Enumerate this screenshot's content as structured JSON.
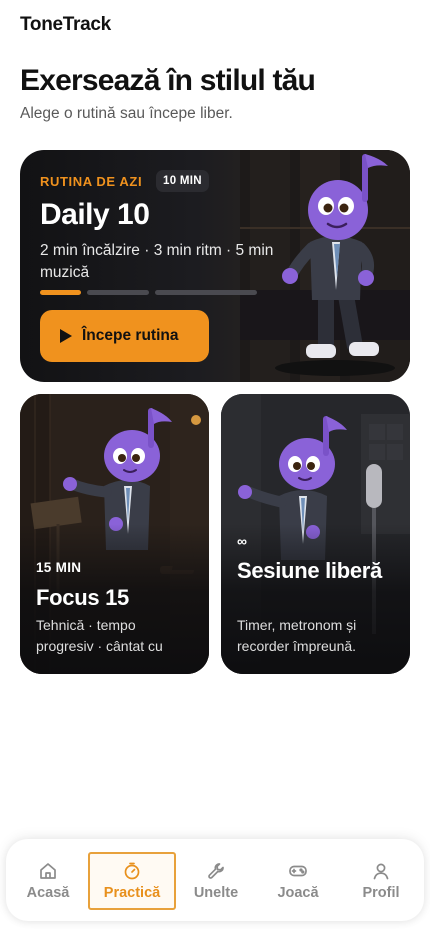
{
  "app": {
    "title": "ToneTrack"
  },
  "page": {
    "title": "Exersează în stilul tău",
    "subtitle": "Alege o rutină sau începe liber."
  },
  "hero": {
    "kicker": "RUTINA DE AZI",
    "badge": "10 MIN",
    "title": "Daily 10",
    "description": "2 min încălzire · 3 min ritm · 5 min muzică",
    "progress_segments_minutes": [
      2,
      3,
      5
    ],
    "active_segment": 1,
    "cta_label": "Începe rutina"
  },
  "cards": [
    {
      "kicker": "15 MIN",
      "title": "Focus 15",
      "description": "Tehnică · tempo progresiv · cântat cu metronom"
    },
    {
      "kicker": "∞",
      "title": "Sesiune liberă",
      "description": "Timer, metronom și recorder împreună."
    }
  ],
  "nav": {
    "items": [
      {
        "label": "Acasă",
        "icon": "home-icon"
      },
      {
        "label": "Practică",
        "icon": "stopwatch-icon",
        "active": true
      },
      {
        "label": "Unelte",
        "icon": "wrench-icon"
      },
      {
        "label": "Joacă",
        "icon": "gamepad-icon"
      },
      {
        "label": "Profil",
        "icon": "user-icon"
      }
    ]
  },
  "colors": {
    "accent": "#f0921e",
    "card_dark": "#1c1c20",
    "mascot_purple": "#8a62d8",
    "nav_inactive": "#8b8b8b"
  }
}
